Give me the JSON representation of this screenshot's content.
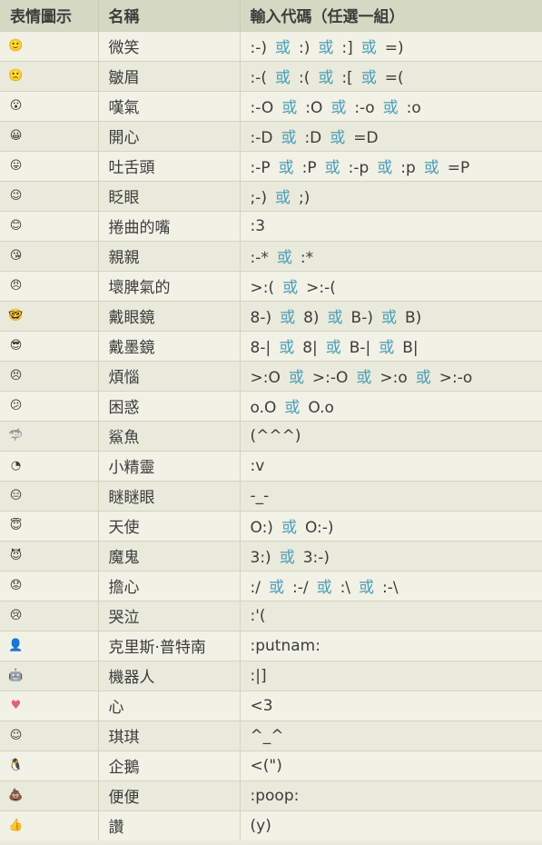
{
  "headers": [
    "表情圖示",
    "名稱",
    "輸入代碼（任選一組）"
  ],
  "or_word": "或",
  "rows": [
    {
      "icon": "smile-icon",
      "glyph": "🙂",
      "name": "微笑",
      "codes": [
        ":-)",
        ":)",
        ":]",
        "=)"
      ]
    },
    {
      "icon": "frown-icon",
      "glyph": "🙁",
      "name": "皺眉",
      "codes": [
        ":-(",
        ":(",
        ":[",
        "=("
      ]
    },
    {
      "icon": "gasp-icon",
      "glyph": "😮",
      "name": "嘆氣",
      "codes": [
        ":-O",
        ":O",
        ":-o",
        ":o"
      ]
    },
    {
      "icon": "grin-icon",
      "glyph": "😀",
      "name": "開心",
      "codes": [
        ":-D",
        ":D",
        "=D"
      ]
    },
    {
      "icon": "tongue-icon",
      "glyph": "😛",
      "name": "吐舌頭",
      "codes": [
        ":-P",
        ":P",
        ":-p",
        ":p",
        "=P"
      ]
    },
    {
      "icon": "wink-icon",
      "glyph": "😉",
      "name": "眨眼",
      "codes": [
        ";-)",
        ";)"
      ]
    },
    {
      "icon": "curly-lips-icon",
      "glyph": "😊",
      "name": "捲曲的嘴",
      "codes": [
        ":3"
      ]
    },
    {
      "icon": "kiss-icon",
      "glyph": "😘",
      "name": "親親",
      "codes": [
        ":-*",
        ":*"
      ]
    },
    {
      "icon": "grumpy-icon",
      "glyph": "😠",
      "name": "壞脾氣的",
      "codes": [
        ">:(",
        ">:-("
      ]
    },
    {
      "icon": "glasses-icon",
      "glyph": "🤓",
      "name": "戴眼鏡",
      "codes": [
        "8-)",
        "8)",
        "B-)",
        "B)"
      ]
    },
    {
      "icon": "sunglasses-icon",
      "glyph": "😎",
      "name": "戴墨鏡",
      "codes": [
        "8-|",
        "8|",
        "B-|",
        "B|"
      ]
    },
    {
      "icon": "upset-icon",
      "glyph": "😣",
      "name": "煩惱",
      "codes": [
        ">:O",
        ">:-O",
        ">:o",
        ">:-o"
      ]
    },
    {
      "icon": "confused-icon",
      "glyph": "😕",
      "name": "困惑",
      "codes": [
        "o.O",
        "O.o"
      ]
    },
    {
      "icon": "shark-icon",
      "glyph": "🦈",
      "name": "鯊魚",
      "codes": [
        "(^^^)"
      ]
    },
    {
      "icon": "pacman-icon",
      "glyph": "◔",
      "name": "小精靈",
      "codes": [
        ":v"
      ]
    },
    {
      "icon": "squint-icon",
      "glyph": "😑",
      "name": "瞇瞇眼",
      "codes": [
        "-_-"
      ]
    },
    {
      "icon": "angel-icon",
      "glyph": "😇",
      "name": "天使",
      "codes": [
        "O:)",
        "O:-)"
      ]
    },
    {
      "icon": "devil-icon",
      "glyph": "😈",
      "name": "魔鬼",
      "codes": [
        "3:)",
        "3:-)"
      ]
    },
    {
      "icon": "worried-icon",
      "glyph": "😟",
      "name": "擔心",
      "codes": [
        ":/",
        ":-/",
        ":\\",
        ":-\\"
      ]
    },
    {
      "icon": "cry-icon",
      "glyph": "😢",
      "name": "哭泣",
      "codes": [
        ":'("
      ]
    },
    {
      "icon": "chris-putnam-icon",
      "glyph": "👤",
      "name": "克里斯‧普特南",
      "codes": [
        ":putnam:"
      ]
    },
    {
      "icon": "robot-icon",
      "glyph": "🤖",
      "name": "機器人",
      "codes": [
        ":|]"
      ]
    },
    {
      "icon": "heart-icon",
      "glyph": "♥",
      "name": "心",
      "codes": [
        "<3"
      ]
    },
    {
      "icon": "kiki-icon",
      "glyph": "☺",
      "name": "琪琪",
      "codes": [
        "^_^"
      ]
    },
    {
      "icon": "penguin-icon",
      "glyph": "🐧",
      "name": "企鵝",
      "codes": [
        "<(\")"
      ]
    },
    {
      "icon": "poop-icon",
      "glyph": "💩",
      "name": "便便",
      "codes": [
        ":poop:"
      ]
    },
    {
      "icon": "thumbs-up-icon",
      "glyph": "👍",
      "name": "讚",
      "codes": [
        "(y)"
      ]
    }
  ],
  "colors": {
    "header_bg": "#d5d8c3",
    "row_odd_bg": "#f1f1e6",
    "row_even_bg": "#e9eadb",
    "or_text": "#4a9db8",
    "heart": "#e0607a"
  }
}
